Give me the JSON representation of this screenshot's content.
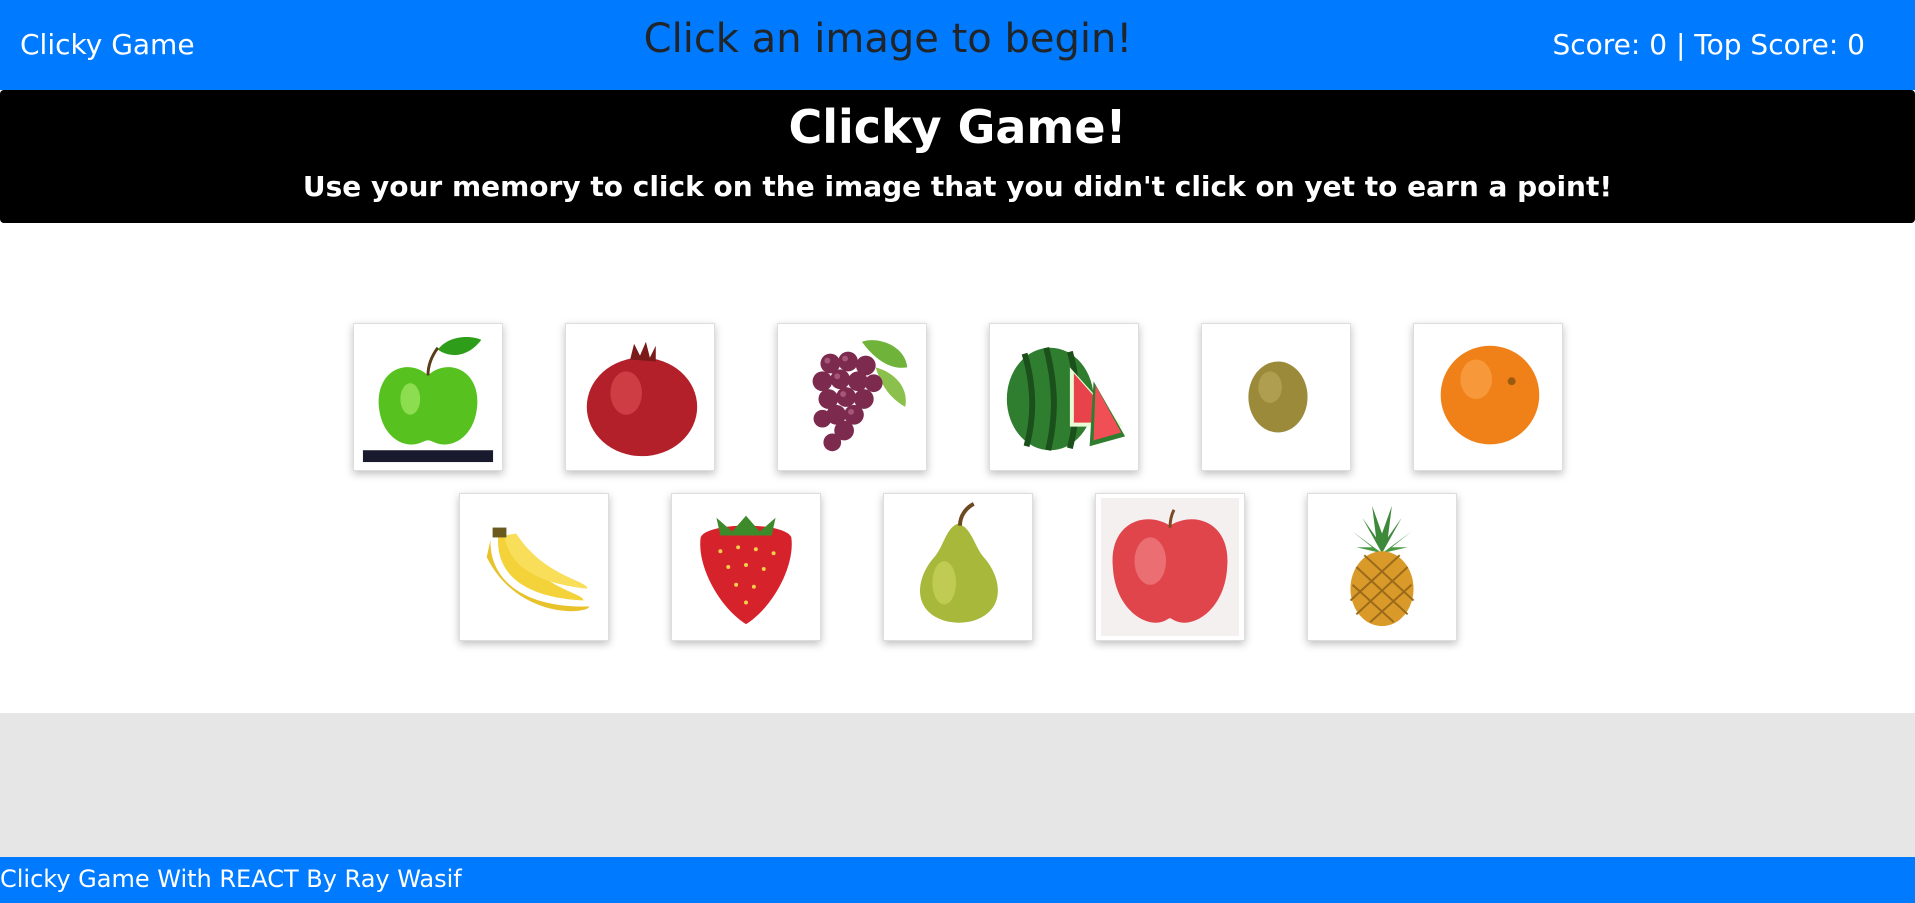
{
  "navbar": {
    "brand": "Clicky Game",
    "status": "Click an image to begin!",
    "score": "Score: 0 | Top Score: 0"
  },
  "jumbotron": {
    "title": "Clicky Game!",
    "subtitle": "Use your memory to click on the image that you didn't click on yet to earn a point!"
  },
  "cards": [
    {
      "icon": "green-apple-icon"
    },
    {
      "icon": "pomegranate-icon"
    },
    {
      "icon": "grapes-icon"
    },
    {
      "icon": "watermelon-icon"
    },
    {
      "icon": "kiwi-icon"
    },
    {
      "icon": "orange-icon"
    },
    {
      "icon": "banana-icon"
    },
    {
      "icon": "strawberry-icon"
    },
    {
      "icon": "pear-icon"
    },
    {
      "icon": "red-apple-icon"
    },
    {
      "icon": "pineapple-icon"
    }
  ],
  "footer": {
    "text": "Clicky Game With REACT By Ray Wasif"
  },
  "colors": {
    "primary": "#007bff",
    "jumbotron": "#000000",
    "status_text": "#212529",
    "footer_band": "#e6e6e6"
  }
}
